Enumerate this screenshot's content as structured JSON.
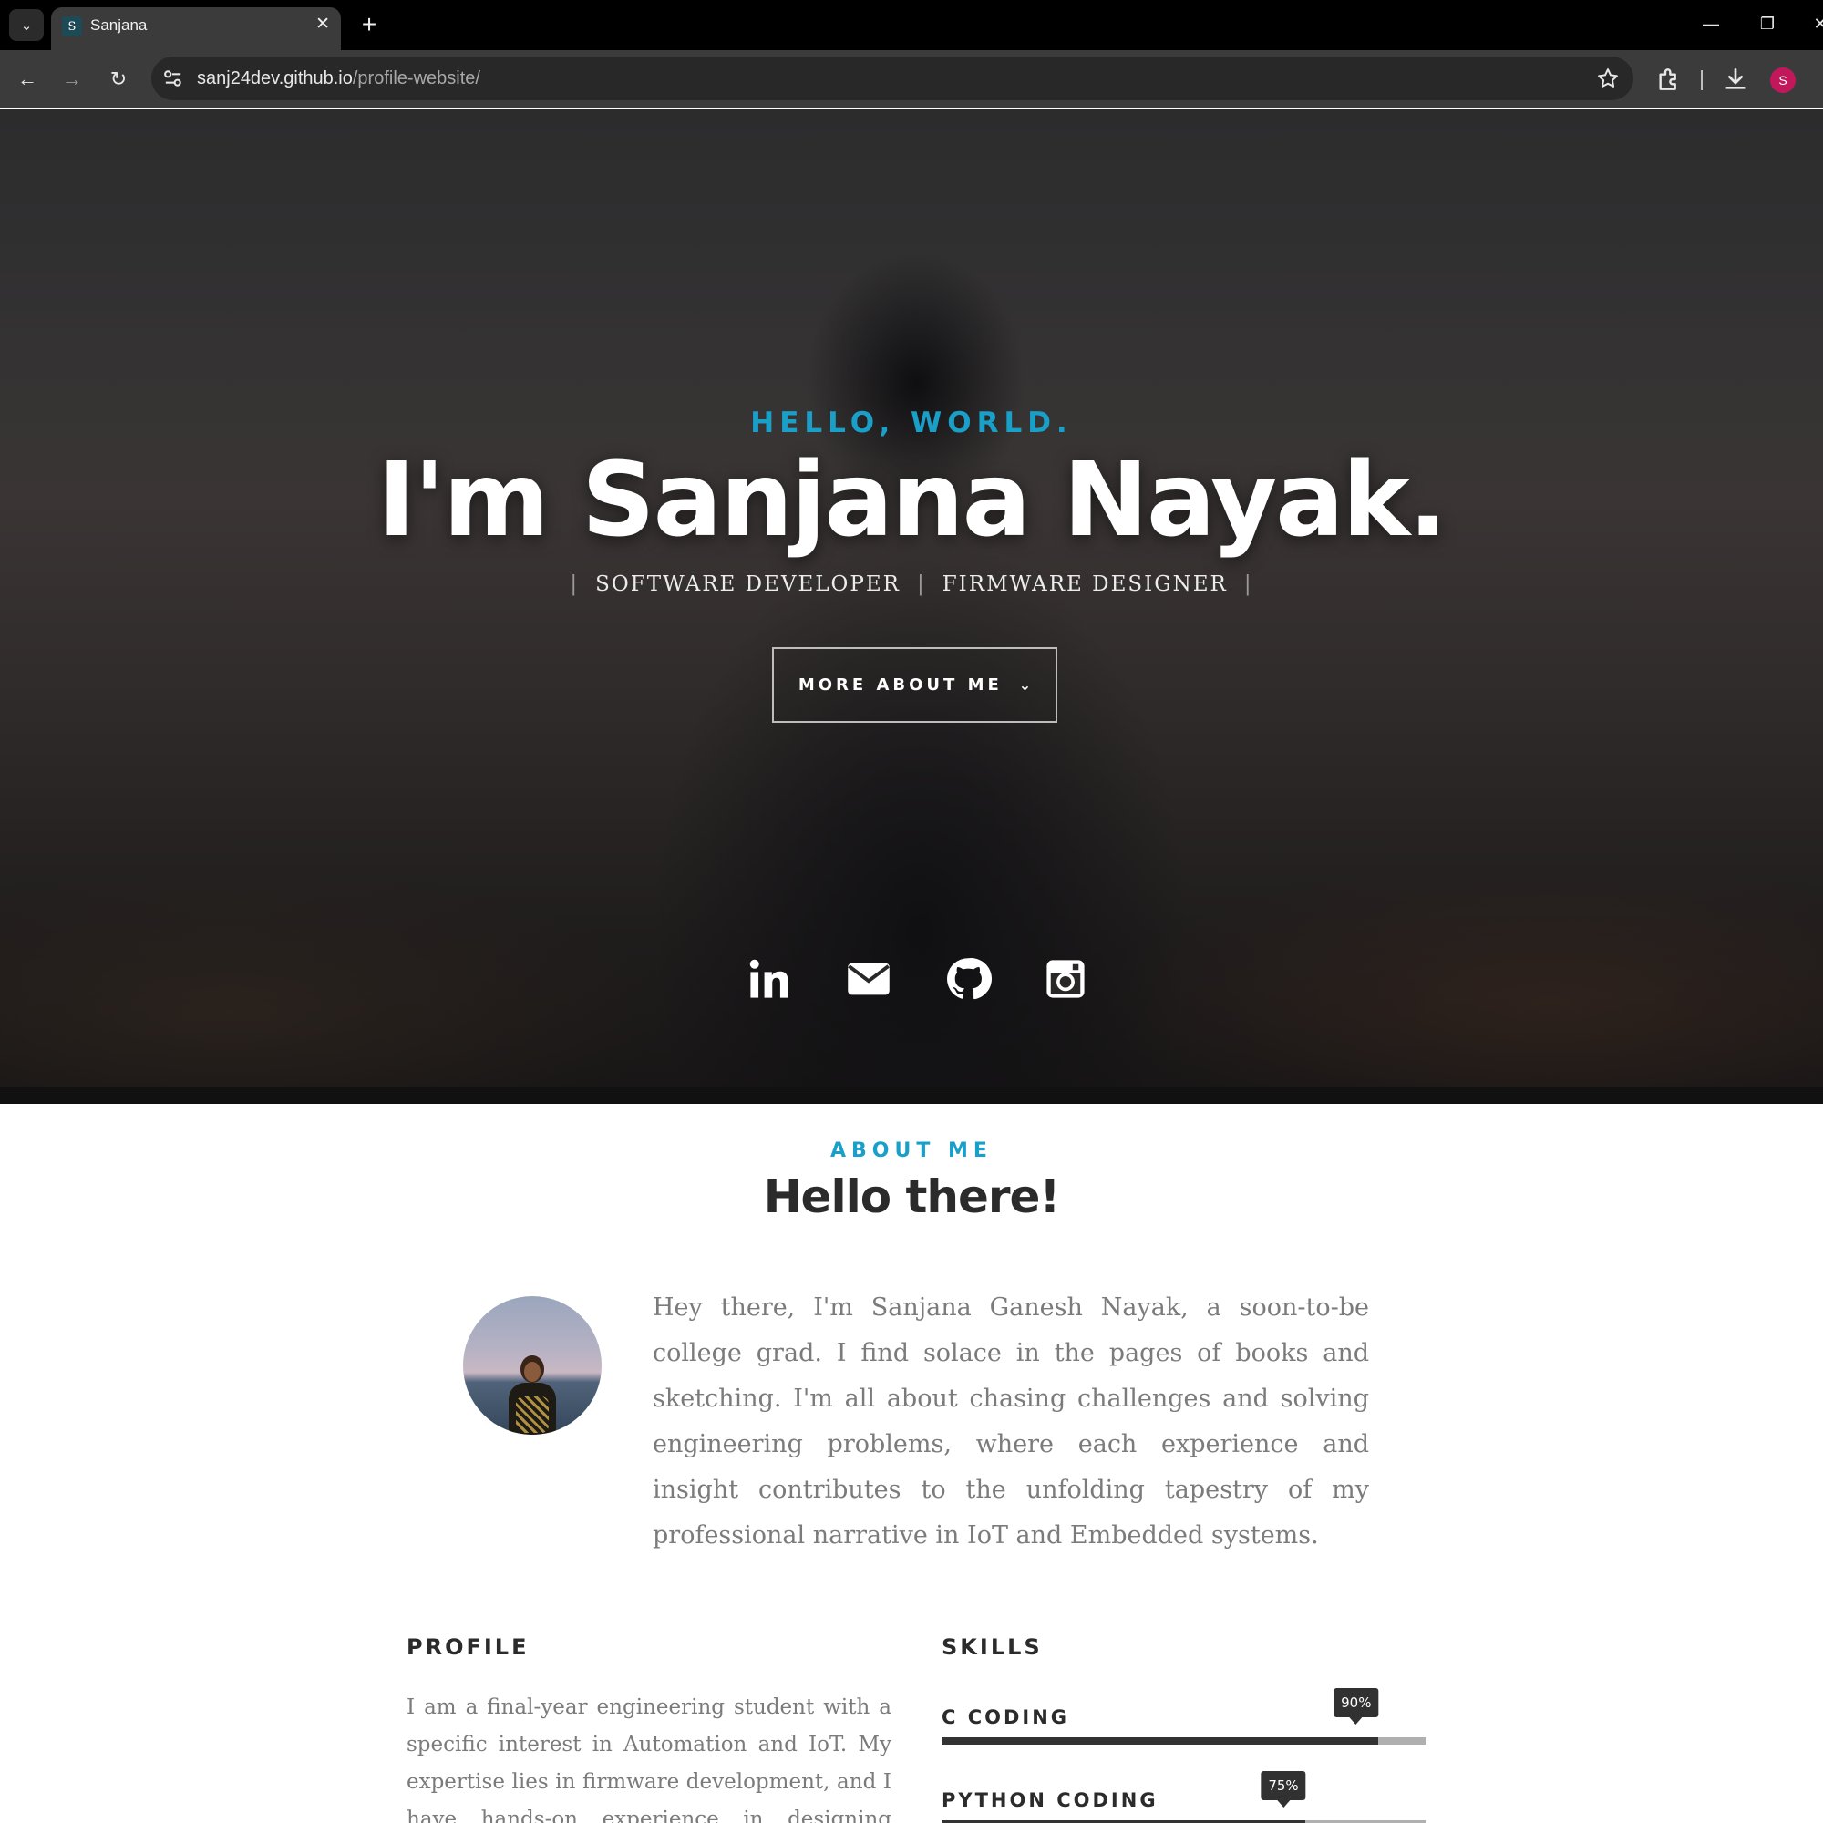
{
  "browser": {
    "tab_title": "Sanjana",
    "tab_favicon_letter": "S",
    "url_host": "sanj24dev.github.io",
    "url_path": "/profile-website/",
    "profile_initial": "S"
  },
  "hero": {
    "kicker": "HELLO, WORLD.",
    "name": "I'm Sanjana Nayak.",
    "roles": [
      "SOFTWARE DEVELOPER",
      "FIRMWARE DESIGNER"
    ],
    "button_label": "MORE ABOUT ME",
    "social_icons": [
      "linkedin-icon",
      "email-icon",
      "github-icon",
      "instagram-icon"
    ]
  },
  "about": {
    "kicker": "ABOUT ME",
    "title": "Hello there!",
    "intro": "Hey there, I'm Sanjana Ganesh Nayak, a soon-to-be college grad. I find solace in the pages of books and sketching. I'm all about chasing challenges and solving engineering problems, where each experience and insight contributes to the unfolding tapestry of my professional narrative in IoT and Embedded systems."
  },
  "profile": {
    "heading": "PROFILE",
    "text": "I am a final-year engineering student with a specific interest in Automation and IoT. My expertise lies in firmware development, and I have hands-on experience in designing software"
  },
  "skills": {
    "heading": "SKILLS",
    "items": [
      {
        "name": "C CODING",
        "percent_label": "90%",
        "level": 0.9
      },
      {
        "name": "PYTHON CODING",
        "percent_label": "75%",
        "level": 0.75
      }
    ]
  },
  "colors": {
    "accent": "#1a9fc9",
    "heading_dark": "#2b2b2b",
    "body_text": "#7b7b7b",
    "skill_bar_fill": "#333333",
    "skill_bar_track": "#b0b0b0",
    "profile_avatar": "#c2185b"
  }
}
